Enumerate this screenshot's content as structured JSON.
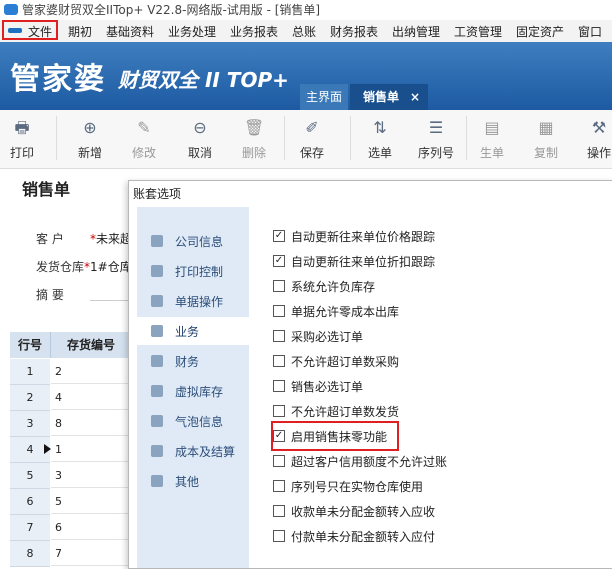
{
  "window": {
    "title": "管家婆财贸双全IITop+ V22.8-网络版-试用版 - [销售单]"
  },
  "menu": {
    "file": "文件",
    "items": [
      "期初",
      "基础资料",
      "业务处理",
      "业务报表",
      "总账",
      "财务报表",
      "出纳管理",
      "工资管理",
      "固定资产",
      "窗口"
    ]
  },
  "banner": {
    "brand": "管家婆",
    "brand2": "财贸双全 II TOP+"
  },
  "tabs": {
    "home": "主界面",
    "sales": "销售单",
    "close": "×"
  },
  "toolbar": {
    "print": "打印",
    "add": "新增",
    "modify": "修改",
    "cancel": "取消",
    "delete": "删除",
    "save": "保存",
    "select": "选单",
    "serial": "序列号",
    "generate": "生单",
    "copy": "复制",
    "operate": "操作"
  },
  "form": {
    "title": "销售单",
    "customer_label": "客 户",
    "customer_value": "未来超市",
    "warehouse_label": "发货仓库",
    "warehouse_value": "1#仓库",
    "summary_label": "摘 要"
  },
  "grid": {
    "headers": {
      "row": "行号",
      "code": "存货编号"
    },
    "rows": [
      {
        "n": "1",
        "v": "2"
      },
      {
        "n": "2",
        "v": "4"
      },
      {
        "n": "3",
        "v": "8"
      },
      {
        "n": "4",
        "v": "1"
      },
      {
        "n": "5",
        "v": "3"
      },
      {
        "n": "6",
        "v": "5"
      },
      {
        "n": "7",
        "v": "6"
      },
      {
        "n": "8",
        "v": "7"
      }
    ]
  },
  "dialog": {
    "title": "账套选项",
    "sidebar": [
      "公司信息",
      "打印控制",
      "单据操作",
      "业务",
      "财务",
      "虚拟库存",
      "气泡信息",
      "成本及结算",
      "其他"
    ],
    "selected": "业务",
    "options": [
      {
        "label": "自动更新往来单位价格跟踪",
        "checked": true
      },
      {
        "label": "自动更新往来单位折扣跟踪",
        "checked": true
      },
      {
        "label": "系统允许负库存",
        "checked": false
      },
      {
        "label": "单据允许零成本出库",
        "checked": false
      },
      {
        "label": "采购必选订单",
        "checked": false
      },
      {
        "label": "不允许超订单数采购",
        "checked": false
      },
      {
        "label": "销售必选订单",
        "checked": false
      },
      {
        "label": "不允许超订单数发货",
        "checked": false
      },
      {
        "label": "启用销售抹零功能",
        "checked": true
      },
      {
        "label": "超过客户信用额度不允许过账",
        "checked": false
      },
      {
        "label": "序列号只在实物仓库使用",
        "checked": false
      },
      {
        "label": "收款单未分配金额转入应收",
        "checked": false
      },
      {
        "label": "付款单未分配金额转入应付",
        "checked": false
      }
    ]
  }
}
